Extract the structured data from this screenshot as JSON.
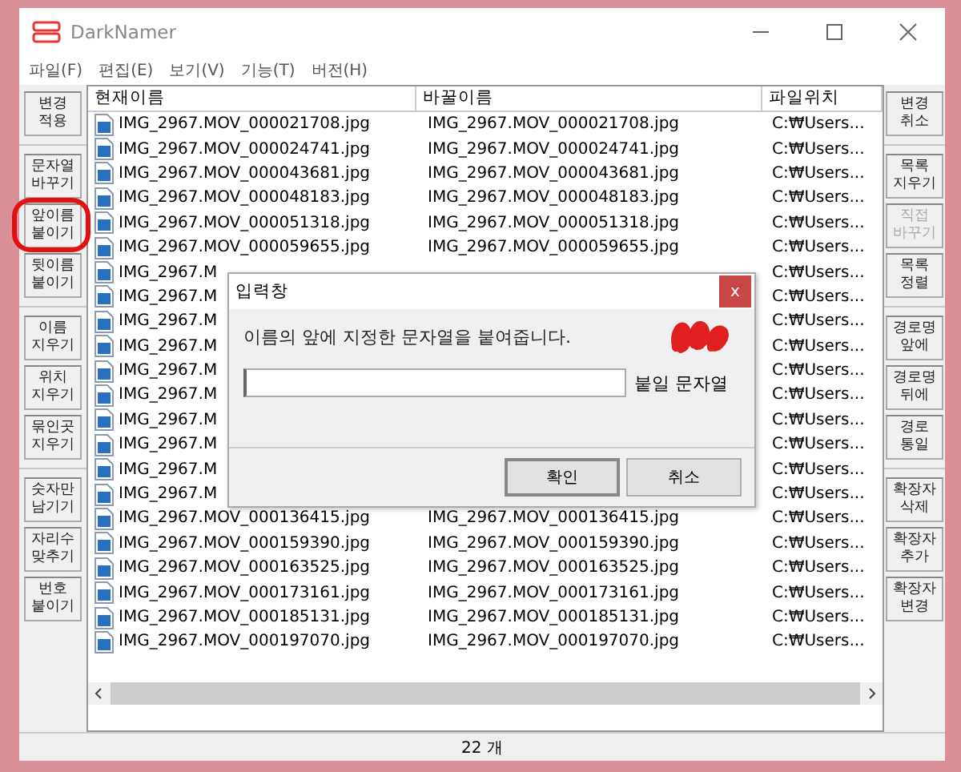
{
  "window": {
    "title": "DarkNamer"
  },
  "menu": [
    "파일(F)",
    "편집(E)",
    "보기(V)",
    "기능(T)",
    "버전(H)"
  ],
  "left_groups": [
    [
      {
        "label": "변경\n적용",
        "disabled": false
      }
    ],
    [
      {
        "label": "문자열\n바꾸기",
        "disabled": false
      },
      {
        "label": "앞이름\n붙이기",
        "disabled": false
      },
      {
        "label": "뒷이름\n붙이기",
        "disabled": false
      }
    ],
    [
      {
        "label": "이름\n지우기",
        "disabled": false
      },
      {
        "label": "위치\n지우기",
        "disabled": false
      },
      {
        "label": "묶인곳\n지우기",
        "disabled": false
      }
    ],
    [
      {
        "label": "숫자만\n남기기",
        "disabled": false
      },
      {
        "label": "자리수\n맞추기",
        "disabled": false
      },
      {
        "label": "번호\n붙이기",
        "disabled": false
      }
    ]
  ],
  "right_groups": [
    [
      {
        "label": "변경\n취소",
        "disabled": false
      }
    ],
    [
      {
        "label": "목록\n지우기",
        "disabled": false
      },
      {
        "label": "직접\n바꾸기",
        "disabled": true
      },
      {
        "label": "목록\n정렬",
        "disabled": false
      }
    ],
    [
      {
        "label": "경로명\n앞에",
        "disabled": false
      },
      {
        "label": "경로명\n뒤에",
        "disabled": false
      },
      {
        "label": "경로\n통일",
        "disabled": false
      }
    ],
    [
      {
        "label": "확장자\n삭제",
        "disabled": false
      },
      {
        "label": "확장자\n추가",
        "disabled": false
      },
      {
        "label": "확장자\n변경",
        "disabled": false
      }
    ]
  ],
  "table": {
    "columns": [
      "현재이름",
      "바꿀이름",
      "파일위치"
    ],
    "rows": [
      {
        "name": "IMG_2967.MOV_000021708.jpg",
        "new_name": "IMG_2967.MOV_000021708.jpg",
        "location": "C:₩Users..."
      },
      {
        "name": "IMG_2967.MOV_000024741.jpg",
        "new_name": "IMG_2967.MOV_000024741.jpg",
        "location": "C:₩Users..."
      },
      {
        "name": "IMG_2967.MOV_000043681.jpg",
        "new_name": "IMG_2967.MOV_000043681.jpg",
        "location": "C:₩Users..."
      },
      {
        "name": "IMG_2967.MOV_000048183.jpg",
        "new_name": "IMG_2967.MOV_000048183.jpg",
        "location": "C:₩Users..."
      },
      {
        "name": "IMG_2967.MOV_000051318.jpg",
        "new_name": "IMG_2967.MOV_000051318.jpg",
        "location": "C:₩Users..."
      },
      {
        "name": "IMG_2967.MOV_000059655.jpg",
        "new_name": "IMG_2967.MOV_000059655.jpg",
        "location": "C:₩Users..."
      },
      {
        "name": "IMG_2967.M",
        "location": "C:₩Users..."
      },
      {
        "name": "IMG_2967.M",
        "location": "C:₩Users..."
      },
      {
        "name": "IMG_2967.M",
        "location": "C:₩Users..."
      },
      {
        "name": "IMG_2967.M",
        "location": "C:₩Users..."
      },
      {
        "name": "IMG_2967.M",
        "location": "C:₩Users..."
      },
      {
        "name": "IMG_2967.M",
        "location": "C:₩Users..."
      },
      {
        "name": "IMG_2967.M",
        "location": "C:₩Users..."
      },
      {
        "name": "IMG_2967.M",
        "location": "C:₩Users..."
      },
      {
        "name": "IMG_2967.M",
        "location": "C:₩Users..."
      },
      {
        "name": "IMG_2967.M",
        "location": "C:₩Users..."
      },
      {
        "name": "IMG_2967.MOV_000136415.jpg",
        "new_name": "IMG_2967.MOV_000136415.jpg",
        "location": "C:₩Users..."
      },
      {
        "name": "IMG_2967.MOV_000159390.jpg",
        "new_name": "IMG_2967.MOV_000159390.jpg",
        "location": "C:₩Users..."
      },
      {
        "name": "IMG_2967.MOV_000163525.jpg",
        "new_name": "IMG_2967.MOV_000163525.jpg",
        "location": "C:₩Users..."
      },
      {
        "name": "IMG_2967.MOV_000173161.jpg",
        "new_name": "IMG_2967.MOV_000173161.jpg",
        "location": "C:₩Users..."
      },
      {
        "name": "IMG_2967.MOV_000185131.jpg",
        "new_name": "IMG_2967.MOV_000185131.jpg",
        "location": "C:₩Users..."
      },
      {
        "name": "IMG_2967.MOV_000197070.jpg",
        "new_name": "IMG_2967.MOV_000197070.jpg",
        "location": "C:₩Users..."
      }
    ]
  },
  "status_bar": "22 개",
  "dialog": {
    "title": "입력창",
    "close": "x",
    "message": "이름의 앞에 지정한 문자열을 붙여줍니다.",
    "field_label": "붙일 문자열",
    "buttons": [
      {
        "label": "확인",
        "default": true
      },
      {
        "label": "취소",
        "default": false
      }
    ]
  }
}
